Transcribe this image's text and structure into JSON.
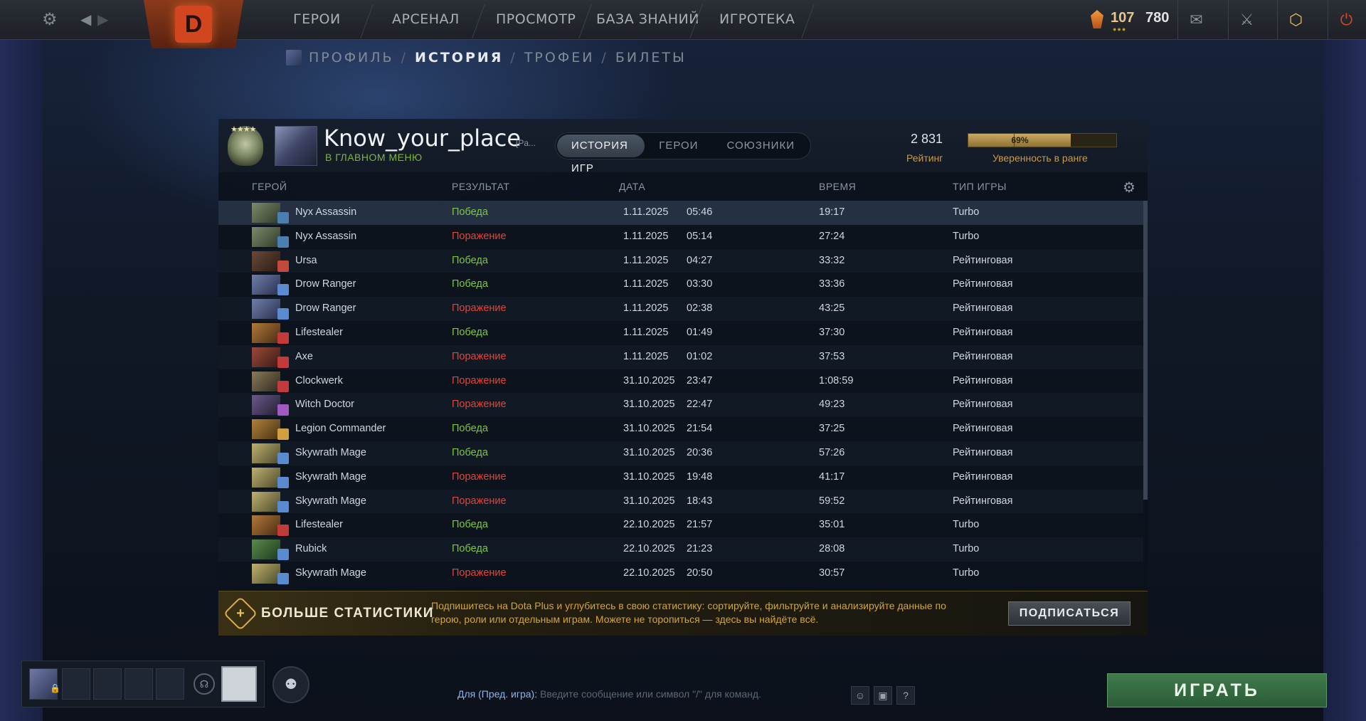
{
  "topbar": {
    "nav": [
      "ГЕРОИ",
      "АРСЕНАЛ",
      "ПРОСМОТР",
      "БАЗА ЗНАНИЙ",
      "ИГРОТЕКА"
    ],
    "currency_shards": "107",
    "currency_other": "780"
  },
  "breadcrumb": {
    "items": [
      "ПРОФИЛЬ",
      "ИСТОРИЯ",
      "ТРОФЕИ",
      "БИЛЕТЫ"
    ],
    "separator": "/"
  },
  "profile": {
    "name": "Know_your_place",
    "tag": "[Pa...",
    "status": "В ГЛАВНОМ МЕНЮ",
    "tabs": [
      "ИСТОРИЯ ИГР",
      "ГЕРОИ",
      "СОЮЗНИКИ"
    ],
    "rating_value": "2 831",
    "rating_label": "Рейтинг",
    "confidence_value": "69%",
    "confidence_fraction": 0.69,
    "confidence_label": "Уверенность в ранге"
  },
  "table": {
    "headers": [
      "ГЕРОЙ",
      "РЕЗУЛЬТАТ",
      "ДАТА",
      "ВРЕМЯ",
      "ТИП ИГРЫ"
    ],
    "rows": [
      {
        "hero": "Nyx Assassin",
        "result": "Победа",
        "win": true,
        "date": "1.11.2025",
        "time": "05:46",
        "duration": "19:17",
        "type": "Turbo"
      },
      {
        "hero": "Nyx Assassin",
        "result": "Поражение",
        "win": false,
        "date": "1.11.2025",
        "time": "05:14",
        "duration": "27:24",
        "type": "Turbo"
      },
      {
        "hero": "Ursa",
        "result": "Победа",
        "win": true,
        "date": "1.11.2025",
        "time": "04:27",
        "duration": "33:32",
        "type": "Рейтинговая"
      },
      {
        "hero": "Drow Ranger",
        "result": "Победа",
        "win": true,
        "date": "1.11.2025",
        "time": "03:30",
        "duration": "33:36",
        "type": "Рейтинговая"
      },
      {
        "hero": "Drow Ranger",
        "result": "Поражение",
        "win": false,
        "date": "1.11.2025",
        "time": "02:38",
        "duration": "43:25",
        "type": "Рейтинговая"
      },
      {
        "hero": "Lifestealer",
        "result": "Победа",
        "win": true,
        "date": "1.11.2025",
        "time": "01:49",
        "duration": "37:30",
        "type": "Рейтинговая"
      },
      {
        "hero": "Axe",
        "result": "Поражение",
        "win": false,
        "date": "1.11.2025",
        "time": "01:02",
        "duration": "37:53",
        "type": "Рейтинговая"
      },
      {
        "hero": "Clockwerk",
        "result": "Поражение",
        "win": false,
        "date": "31.10.2025",
        "time": "23:47",
        "duration": "1:08:59",
        "type": "Рейтинговая"
      },
      {
        "hero": "Witch Doctor",
        "result": "Поражение",
        "win": false,
        "date": "31.10.2025",
        "time": "22:47",
        "duration": "49:23",
        "type": "Рейтинговая"
      },
      {
        "hero": "Legion Commander",
        "result": "Победа",
        "win": true,
        "date": "31.10.2025",
        "time": "21:54",
        "duration": "37:25",
        "type": "Рейтинговая"
      },
      {
        "hero": "Skywrath Mage",
        "result": "Победа",
        "win": true,
        "date": "31.10.2025",
        "time": "20:36",
        "duration": "57:26",
        "type": "Рейтинговая"
      },
      {
        "hero": "Skywrath Mage",
        "result": "Поражение",
        "win": false,
        "date": "31.10.2025",
        "time": "19:48",
        "duration": "41:17",
        "type": "Рейтинговая"
      },
      {
        "hero": "Skywrath Mage",
        "result": "Поражение",
        "win": false,
        "date": "31.10.2025",
        "time": "18:43",
        "duration": "59:52",
        "type": "Рейтинговая"
      },
      {
        "hero": "Lifestealer",
        "result": "Победа",
        "win": true,
        "date": "22.10.2025",
        "time": "21:57",
        "duration": "35:01",
        "type": "Turbo"
      },
      {
        "hero": "Rubick",
        "result": "Победа",
        "win": true,
        "date": "22.10.2025",
        "time": "21:23",
        "duration": "28:08",
        "type": "Turbo"
      },
      {
        "hero": "Skywrath Mage",
        "result": "Поражение",
        "win": false,
        "date": "22.10.2025",
        "time": "20:50",
        "duration": "30:57",
        "type": "Turbo"
      }
    ]
  },
  "promo": {
    "title": "БОЛЬШЕ СТАТИСТИКИ",
    "text": "Подпишитесь на Dota Plus и углубитесь в свою статистику: сортируйте, фильтруйте и анализируйте данные по герою, роли или отдельным играм. Можете не торопиться — здесь вы найдёте всё.",
    "button": "ПОДПИСАТЬСЯ"
  },
  "chat": {
    "prefix": "Для (Пред. игра):",
    "placeholder": "Введите сообщение или символ \"/\" для команд."
  },
  "play_button": "ИГРАТЬ",
  "colors": {
    "win": "#7ec63e",
    "loss": "#e0443a",
    "accent_gold": "#c99b4e",
    "play_green": "#3f7a4c"
  },
  "icons": {
    "settings": "gear-icon",
    "back": "arrow-left-icon",
    "forward": "arrow-right-icon",
    "mail": "mail-icon",
    "armory": "swords-icon",
    "dota_plus": "dota-plus-icon",
    "power": "power-icon"
  }
}
